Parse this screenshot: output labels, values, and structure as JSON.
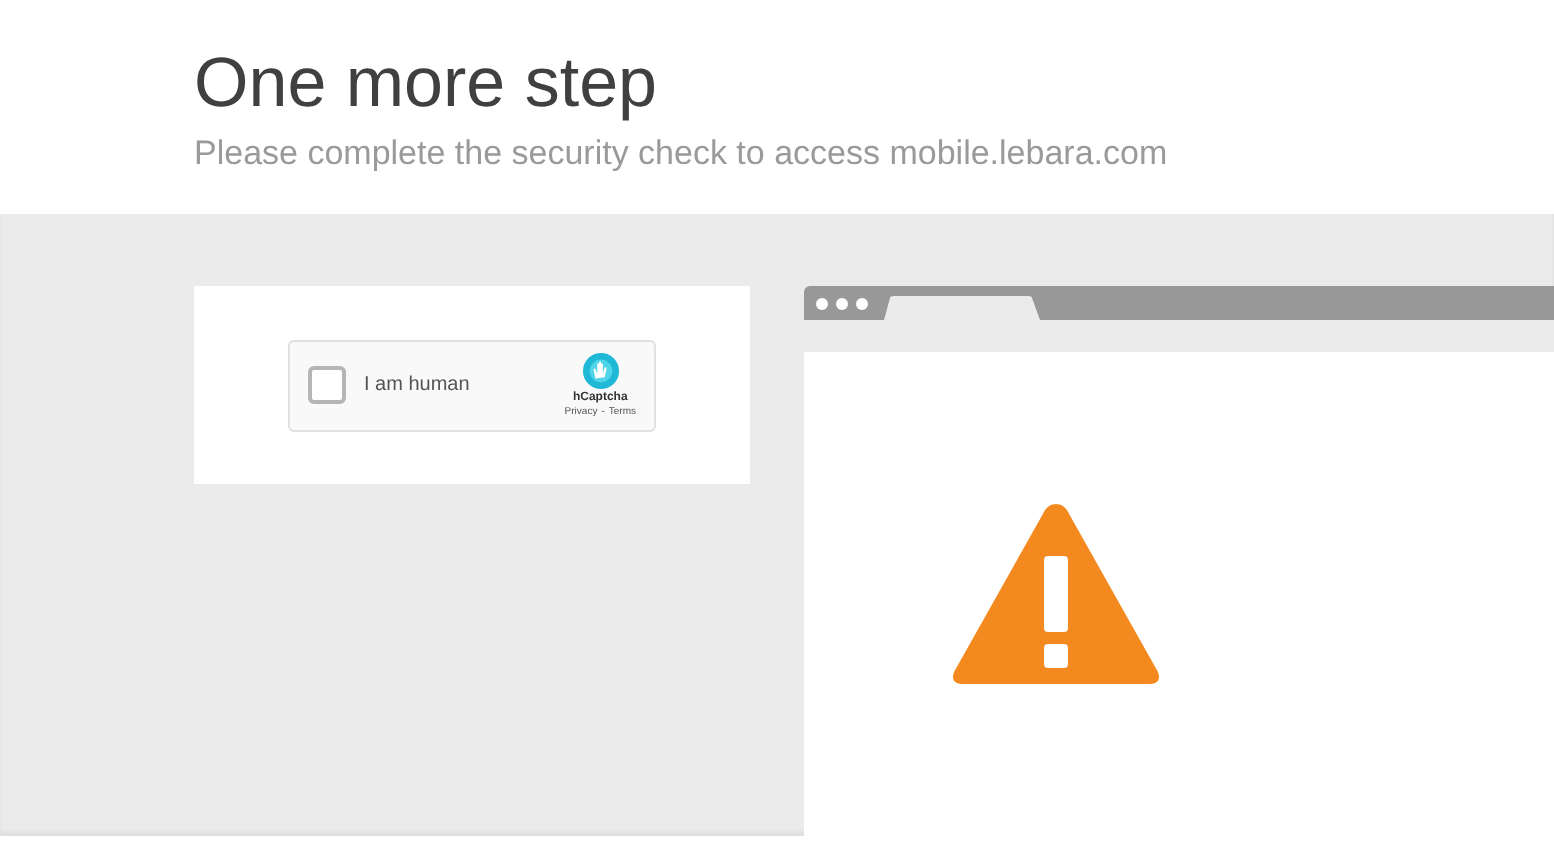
{
  "header": {
    "title": "One more step",
    "subtitle": "Please complete the security check to access mobile.lebara.com"
  },
  "captcha": {
    "label": "I am human",
    "checked": false,
    "brand": "hCaptcha",
    "privacy_link": "Privacy",
    "separator": "-",
    "terms_link": "Terms"
  }
}
